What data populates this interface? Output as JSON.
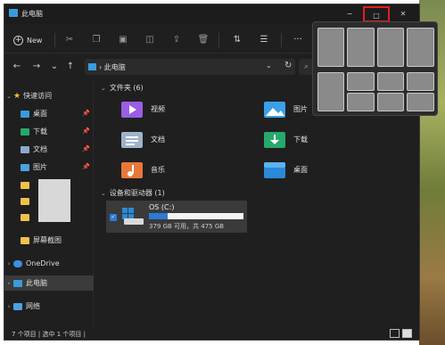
{
  "window": {
    "title": "此电脑"
  },
  "titlebar": {
    "min_glyph": "−",
    "max_glyph": "□",
    "close_glyph": "✕"
  },
  "toolbar": {
    "new_label": "New",
    "more_glyph": "···",
    "icons": [
      "cut-icon",
      "copy-icon",
      "paste-icon",
      "rename-icon",
      "share-icon",
      "delete-icon",
      "sort-icon",
      "view-icon"
    ]
  },
  "address": {
    "path": "› 此电脑",
    "chevron": "⌄",
    "refresh": "↻"
  },
  "nav": {
    "back": "←",
    "forward": "→",
    "recent": "⌄",
    "up": "↑"
  },
  "sidebar": {
    "quick_access": "快速访问",
    "items": [
      {
        "label": "桌面"
      },
      {
        "label": "下载"
      },
      {
        "label": "文档"
      },
      {
        "label": "图片"
      },
      {
        "label": "屏幕截图"
      }
    ],
    "onedrive": "OneDrive",
    "this_pc": "此电脑",
    "network": "网络"
  },
  "folders": {
    "header": "文件夹 (6)",
    "items": [
      {
        "label": "视频",
        "icon": "video-folder-icon"
      },
      {
        "label": "图片",
        "icon": "pictures-folder-icon"
      },
      {
        "label": "文档",
        "icon": "documents-folder-icon"
      },
      {
        "label": "下载",
        "icon": "downloads-folder-icon"
      },
      {
        "label": "音乐",
        "icon": "music-folder-icon"
      },
      {
        "label": "桌面",
        "icon": "desktop-folder-icon"
      }
    ]
  },
  "drives": {
    "header": "设备和驱动器 (1)",
    "items": [
      {
        "name": "OS (C:)",
        "info": "379 GB 可用，共 475 GB",
        "used_fraction": 0.2
      }
    ]
  },
  "status": {
    "text": "7 个项目  |  选中 1 个项目  |"
  },
  "colors": {
    "accent": "#2b7bd6",
    "highlight_border": "#e0201a",
    "window_bg": "#1f1f1f"
  }
}
